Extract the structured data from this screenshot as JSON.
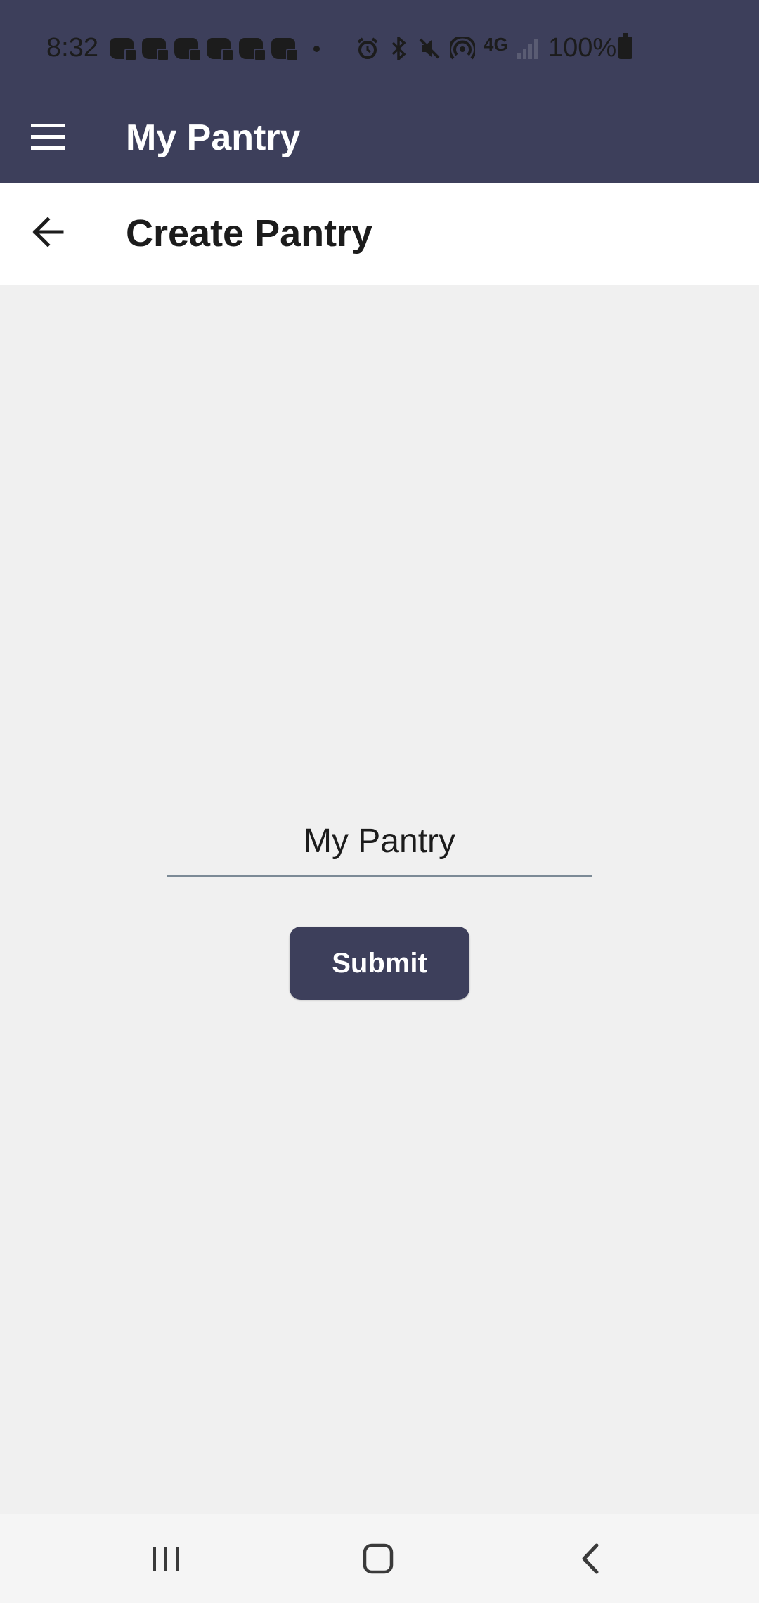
{
  "status_bar": {
    "time": "8:32",
    "battery": "100%",
    "network": "4G",
    "icons": [
      "discord-notification-icon",
      "discord-notification-icon",
      "discord-notification-icon",
      "discord-notification-icon",
      "discord-notification-icon",
      "discord-notification-icon",
      "more-dot-icon",
      "alarm-icon",
      "bluetooth-icon",
      "mute-icon",
      "hotspot-icon",
      "4g-icon",
      "signal-icon",
      "battery-icon"
    ]
  },
  "app_bar": {
    "title": "My Pantry",
    "menu_icon": "hamburger-menu-icon"
  },
  "sub_header": {
    "title": "Create Pantry",
    "back_icon": "arrow-left-icon"
  },
  "form": {
    "name_value": "My Pantry",
    "submit_label": "Submit"
  },
  "nav_bar": {
    "icons": [
      "recent-apps-icon",
      "home-icon",
      "back-icon"
    ]
  },
  "colors": {
    "primary": "#3d3f5b",
    "background": "#f0f0f0",
    "surface": "#ffffff",
    "input_underline": "#7c8a96"
  }
}
